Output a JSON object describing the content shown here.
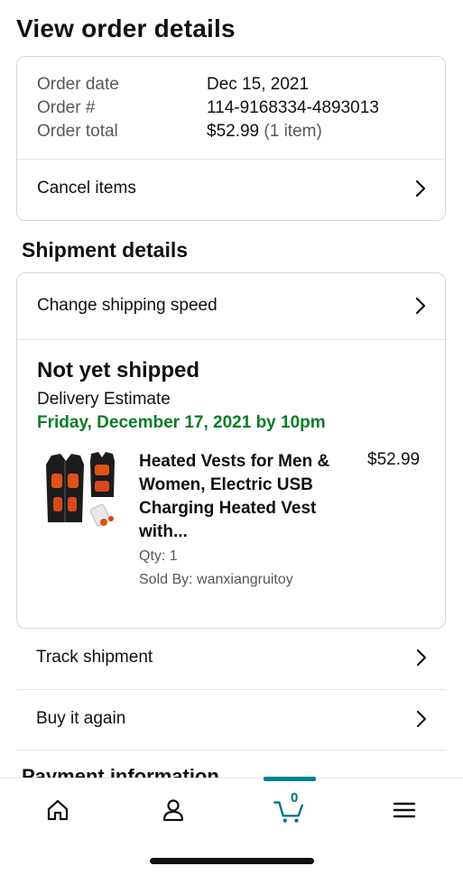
{
  "page": {
    "title": "View order details"
  },
  "summary": {
    "rows": [
      {
        "label": "Order date",
        "value": "Dec 15, 2021"
      },
      {
        "label": "Order #",
        "value": "114-9168334-4893013"
      },
      {
        "label": "Order total",
        "value": "$52.99",
        "extra": "(1 item)"
      }
    ],
    "cancel_label": "Cancel items"
  },
  "shipment": {
    "section_title": "Shipment details",
    "change_speed_label": "Change shipping speed",
    "status": "Not yet shipped",
    "delivery_label": "Delivery Estimate",
    "delivery_date": "Friday, December 17, 2021 by 10pm",
    "delivery_color": "#067d26",
    "item": {
      "title": "Heated Vests for Men & Women, Electric USB Charging Heated Vest with...",
      "price": "$52.99",
      "qty": "Qty: 1",
      "seller": "Sold By: wanxiangruitoy",
      "image": "heated-vest-product-image"
    }
  },
  "actions": {
    "track_label": "Track shipment",
    "buy_again_label": "Buy it again"
  },
  "next_section_peek": "Payment information",
  "tabbar": {
    "tabs": [
      {
        "icon": "home-icon"
      },
      {
        "icon": "account-icon"
      },
      {
        "icon": "cart-icon",
        "count": "0",
        "active": true
      },
      {
        "icon": "menu-icon"
      }
    ],
    "accent": "#008296"
  }
}
